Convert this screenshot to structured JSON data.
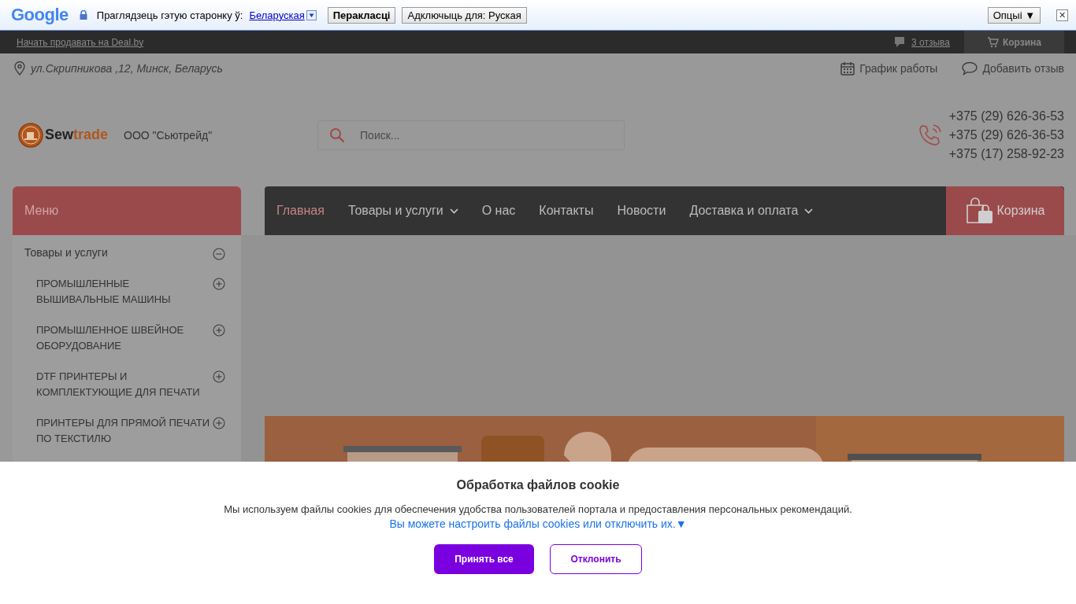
{
  "translate_bar": {
    "brand": "Google",
    "prompt": "Праглядзець гэтую старонку ў:",
    "language": "Беларуская",
    "translate_button": "Перакласці",
    "disable_button": "Адключыць для: Руская",
    "options_button": "Опцыі ▼",
    "close": "✕"
  },
  "top_bar": {
    "sell_link": "Начать продавать на Deal.by",
    "reviews_link": "3 отзыва",
    "cart": "Корзина"
  },
  "info_bar": {
    "address": "ул.Скрипникова ,12, Минск, Беларусь",
    "schedule": "График работы",
    "add_review": "Добавить отзыв"
  },
  "header": {
    "logo": {
      "part_1": "Sew",
      "part_2": "trade"
    },
    "company": "ООО \"Сьютрейд\"",
    "search": {
      "placeholder": "Поиск..."
    },
    "phones": [
      "+375 (29) 626-36-53",
      "+375 (29) 626-36-53",
      "+375 (17) 258-92-23"
    ]
  },
  "menu_title": "Меню",
  "nav": [
    {
      "label": "Главная",
      "selected": true,
      "dropdown": false
    },
    {
      "label": "Товары и услуги",
      "selected": false,
      "dropdown": true
    },
    {
      "label": "О нас",
      "selected": false,
      "dropdown": false
    },
    {
      "label": "Контакты",
      "selected": false,
      "dropdown": false
    },
    {
      "label": "Новости",
      "selected": false,
      "dropdown": false
    },
    {
      "label": "Доставка и оплата",
      "selected": false,
      "dropdown": true
    }
  ],
  "nav_cart": "Корзина",
  "sidebar": {
    "items": [
      {
        "label": "Товары и услуги",
        "expanded": true,
        "children": [
          {
            "label": "ПРОМЫШЛЕННЫЕ ВЫШИВАЛЬНЫЕ МАШИНЫ",
            "expanded": false
          },
          {
            "label": "ПРОМЫШЛЕННОЕ ШВЕЙНОЕ ОБОРУДОВАНИЕ",
            "expanded": false
          },
          {
            "label": "DTF ПРИНТЕРЫ И КОМПЛЕКТУЮЩИЕ ДЛЯ ПЕЧАТИ",
            "expanded": false
          },
          {
            "label": "ПРИНТЕРЫ ДЛЯ ПРЯМОЙ ПЕЧАТИ ПО ТЕКСТИЛЮ",
            "expanded": false
          }
        ]
      }
    ]
  },
  "cookie": {
    "title": "Обработка файлов cookie",
    "text": "Мы используем файлы cookies для обеспечения удобства пользователей портала и предоставления персональных рекомендаций.",
    "settings_link": "Вы можете настроить файлы cookies или отключить их.▼",
    "accept": "Принять все",
    "decline": "Отклонить"
  }
}
